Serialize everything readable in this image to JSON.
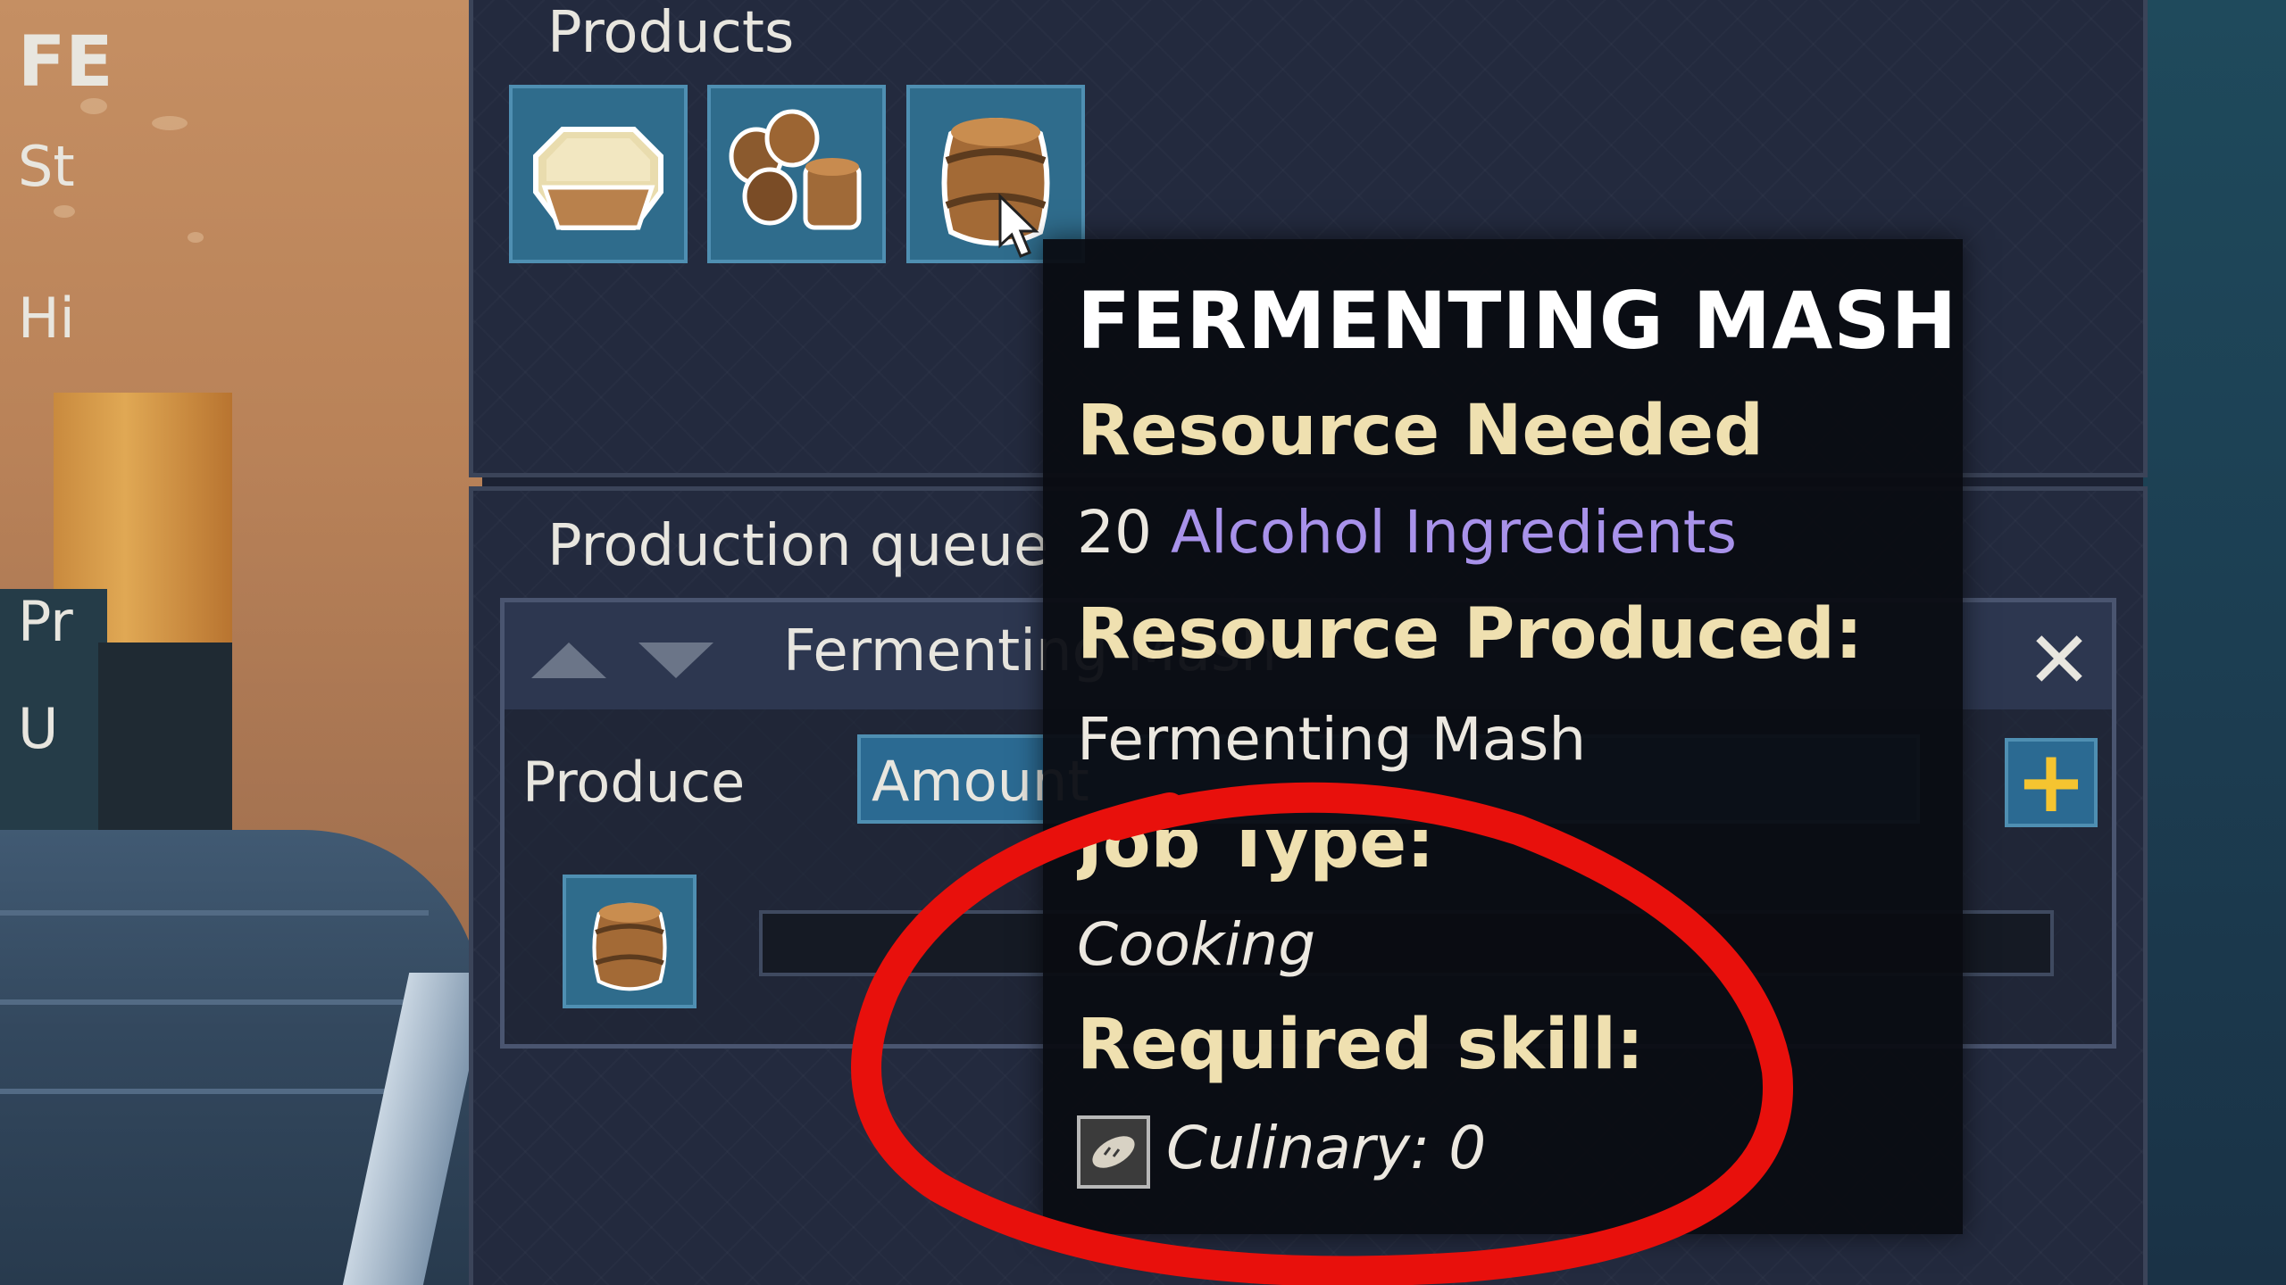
{
  "products_panel": {
    "title": "Products",
    "slots": [
      {
        "icon": "pie-crust-icon"
      },
      {
        "icon": "wood-logs-icon"
      },
      {
        "icon": "barrel-icon"
      }
    ]
  },
  "production_queue": {
    "title": "Production queue",
    "entry": {
      "name": "Fermenting Mash",
      "produce_label": "Produce",
      "amount_text": "Amount",
      "close_icon": "close-icon",
      "plus_icon": "plus-icon",
      "item_icon": "barrel-icon"
    }
  },
  "right_panel": {
    "header": "FE",
    "lines": [
      "St",
      "Hi",
      "Pr",
      "U"
    ]
  },
  "tooltip": {
    "title": "FERMENTING MASH",
    "resource_needed_heading": "Resource Needed",
    "resource_needed_amount": "20",
    "resource_needed_item": "Alcohol Ingredients",
    "resource_produced_heading": "Resource Produced:",
    "resource_produced_value": "Fermenting Mash",
    "job_type_heading": "Job Type:",
    "job_type_value": "Cooking",
    "required_skill_heading": "Required skill:",
    "required_skill_value": "Culinary: 0",
    "skill_icon": "bread-icon"
  },
  "colors": {
    "heading": "#efe0b0",
    "highlight": "#a892ea",
    "annotation": "#e8100c",
    "slot": "#2f6c8c"
  }
}
